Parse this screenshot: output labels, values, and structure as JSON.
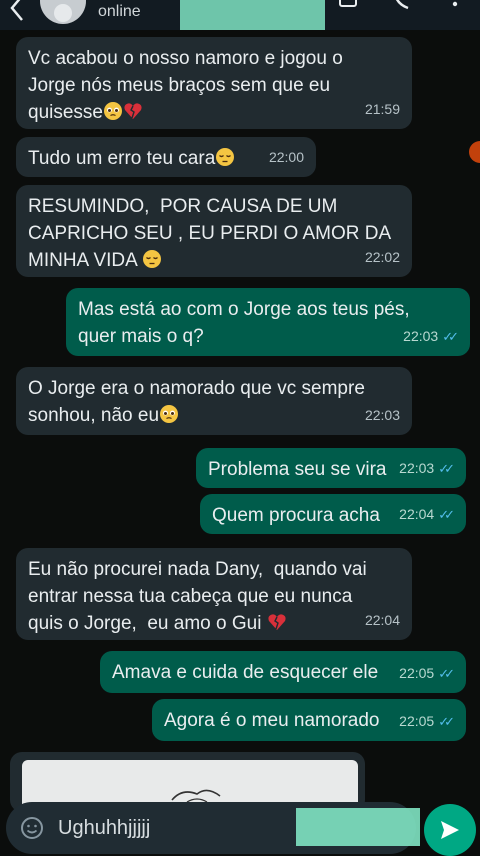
{
  "header": {
    "status": "online"
  },
  "messages": [
    {
      "direction": "in",
      "text": "Vc acabou o nosso namoro e jogou o\nJorge nós meus braços sem que eu\nquisesse",
      "emoji": "pleading-face broken-heart",
      "time": "21:59"
    },
    {
      "direction": "in",
      "text": "Tudo um erro teu cara",
      "emoji": "pensive-face",
      "time": "22:00"
    },
    {
      "direction": "in",
      "text": "RESUMINDO,  POR CAUSA DE UM\nCAPRICHO SEU , EU PERDI O AMOR DA\nMINHA VIDA ",
      "emoji": "pensive-face",
      "time": "22:02"
    },
    {
      "direction": "out",
      "text": "Mas está ao com o Jorge aos teus pés,\nquer mais o q?",
      "time": "22:03"
    },
    {
      "direction": "in",
      "text": "O Jorge era o namorado que vc sempre\nsonhou, não eu",
      "emoji": "pleading-face",
      "time": "22:03"
    },
    {
      "direction": "out",
      "text": "Problema seu se vira",
      "time": "22:03"
    },
    {
      "direction": "out",
      "text": "Quem procura acha",
      "time": "22:04"
    },
    {
      "direction": "in",
      "text": "Eu não procurei nada Dany,  quando vai\nentrar nessa tua cabeça que eu nunca\nquis o Jorge,  eu amo o Gui ",
      "emoji": "broken-heart",
      "time": "22:04"
    },
    {
      "direction": "out",
      "text": "Amava e cuida de esquecer ele",
      "time": "22:05"
    },
    {
      "direction": "out",
      "text": "Agora é o meu namorado",
      "time": "22:05"
    }
  ],
  "input": {
    "value": "Ughuhhjjjjj"
  },
  "colors": {
    "incoming_bubble": "#212b30",
    "outgoing_bubble": "#005c4b",
    "read_ticks": "#53bdeb",
    "accent": "#00a884",
    "redaction": "#7fe3c2"
  }
}
